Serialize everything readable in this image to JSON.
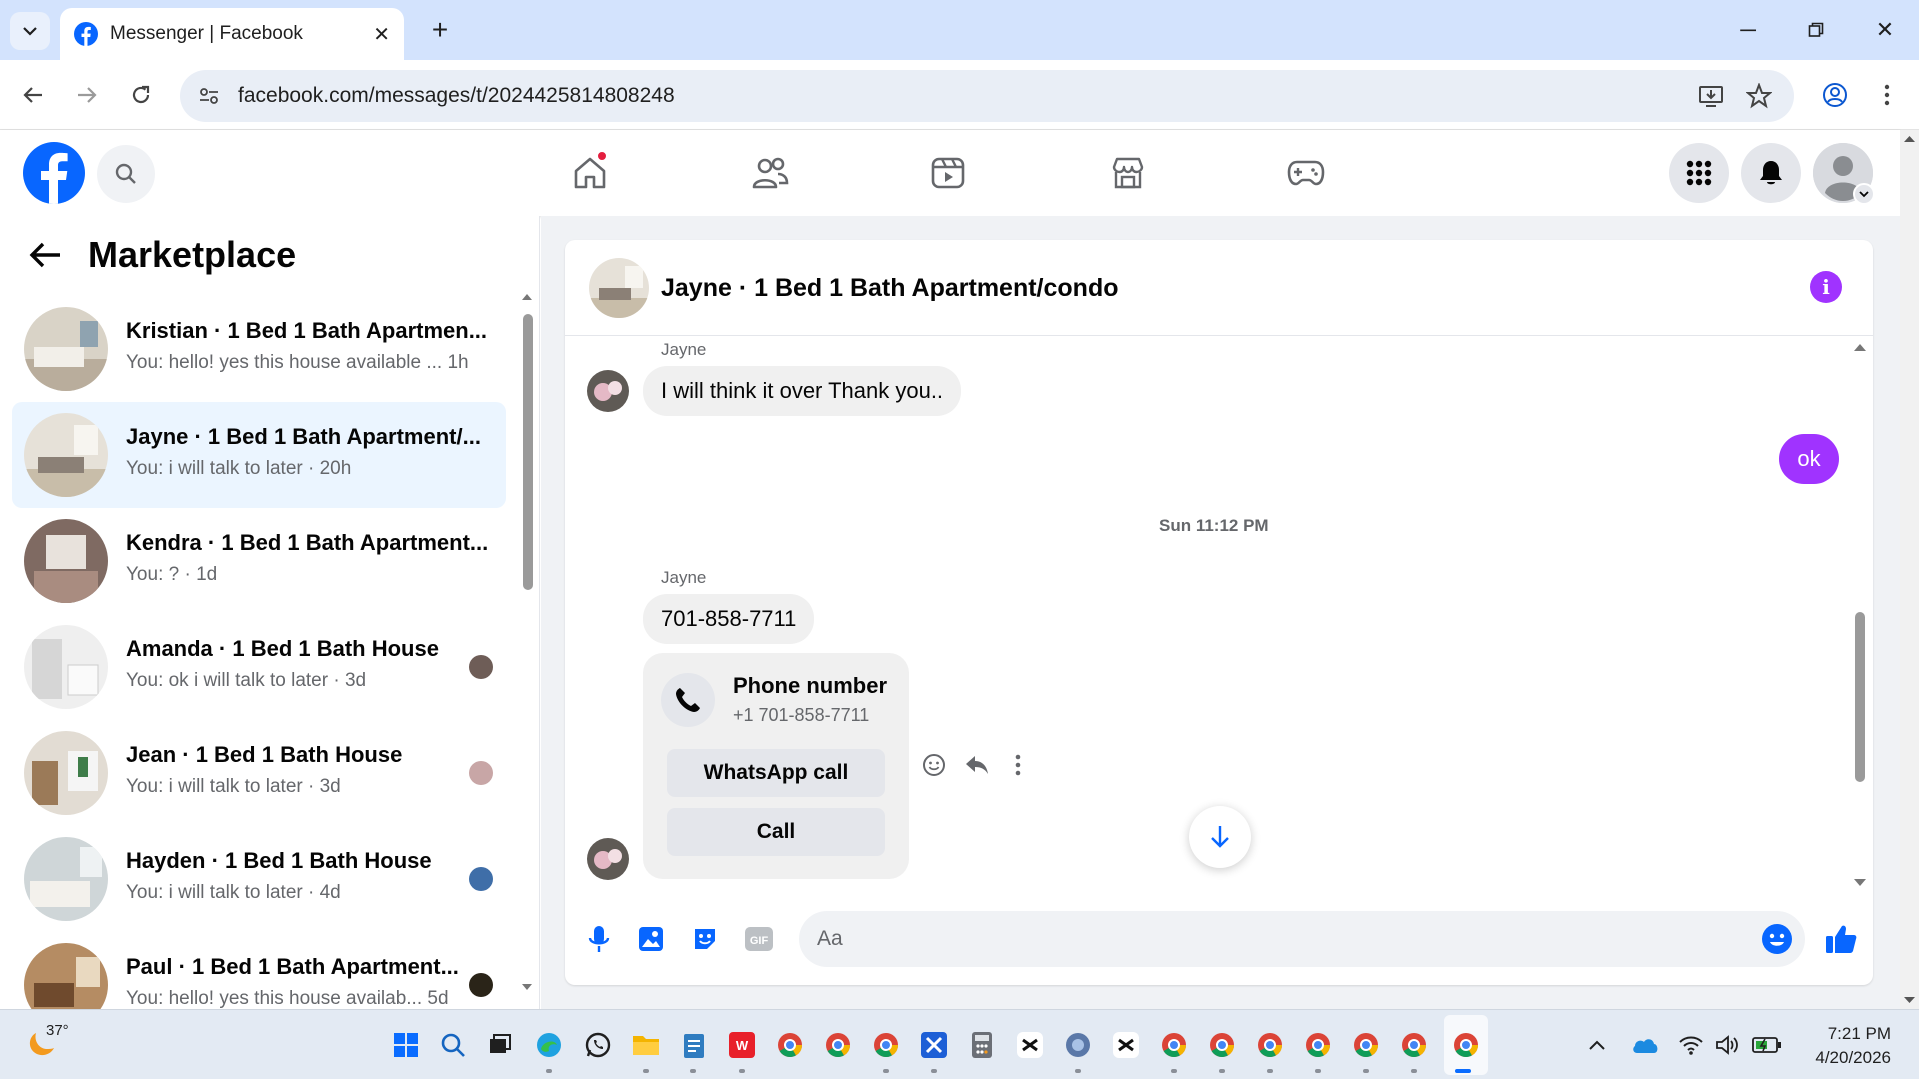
{
  "browser": {
    "tab_title": "Messenger | Facebook",
    "url": "facebook.com/messages/t/2024425814808248"
  },
  "sidebar": {
    "title": "Marketplace",
    "conversations": [
      {
        "name": "Kristian · 1 Bed 1 Bath Apartmen...",
        "preview": "You: hello! yes this house available ...  1h",
        "active": false,
        "thumb_color": "#c9c2b6"
      },
      {
        "name": "Jayne · 1 Bed 1 Bath Apartment/...",
        "preview": "You: i will talk to later · 20h",
        "active": true,
        "thumb_color": "#d7d2c9"
      },
      {
        "name": "Kendra · 1 Bed 1 Bath Apartment...",
        "preview": "You: ? · 1d",
        "active": false,
        "thumb_color": "#8c6f66"
      },
      {
        "name": "Amanda · 1 Bed 1 Bath House",
        "preview": "You: ok i will talk to later · 3d",
        "active": false,
        "thumb_color": "#e8e8e8"
      },
      {
        "name": "Jean · 1 Bed 1 Bath House",
        "preview": "You: i will talk to later · 3d",
        "active": false,
        "thumb_color": "#cfc6bb"
      },
      {
        "name": "Hayden · 1 Bed 1 Bath House",
        "preview": "You: i will talk to later · 4d",
        "active": false,
        "thumb_color": "#bcc5c9"
      },
      {
        "name": "Paul · 1 Bed 1 Bath Apartment...",
        "preview": "You: hello! yes this house availab...  5d",
        "active": false,
        "thumb_color": "#a0764f"
      }
    ]
  },
  "chat": {
    "title": "Jayne · 1 Bed 1 Bath Apartment/condo",
    "messages": {
      "sender1": "Jayne",
      "msg1": "I will think it over Thank you..",
      "reply": "ok",
      "timestamp": "Sun 11:12 PM",
      "sender2": "Jayne",
      "msg2": "701-858-7711"
    },
    "phone_card": {
      "title": "Phone number",
      "number": "+1 701-858-7711",
      "whatsapp_label": "WhatsApp call",
      "call_label": "Call"
    },
    "composer_placeholder": "Aa"
  },
  "taskbar": {
    "temperature": "37°",
    "time": "7:21 PM",
    "date": "4/20/2026"
  },
  "colors": {
    "fb_blue": "#0866ff",
    "messenger_purple": "#a033ff",
    "active_row": "#ebf5ff"
  }
}
